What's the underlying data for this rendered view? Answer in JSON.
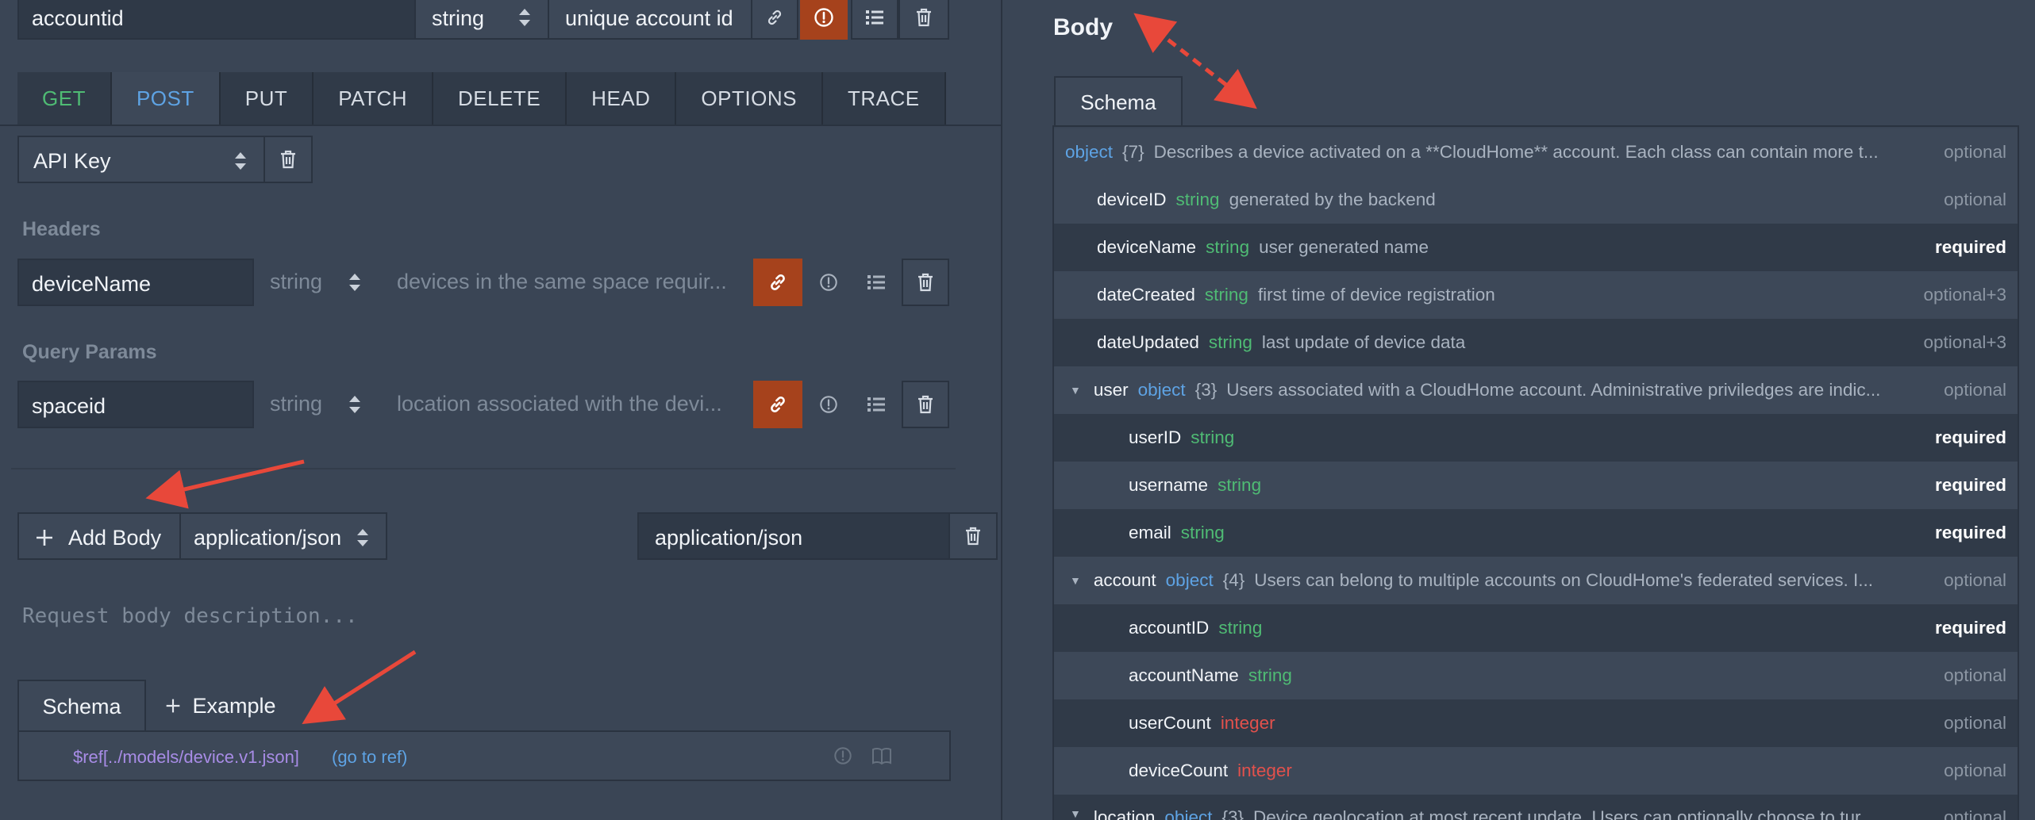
{
  "param_row": {
    "name": "accountid",
    "type": "string",
    "description": "unique account id"
  },
  "methods": [
    "GET",
    "POST",
    "PUT",
    "PATCH",
    "DELETE",
    "HEAD",
    "OPTIONS",
    "TRACE"
  ],
  "active_method": "POST",
  "auth": {
    "selected": "API Key"
  },
  "headers": {
    "label": "Headers",
    "name": "deviceName",
    "type": "string",
    "description": "devices in the same space requir..."
  },
  "query": {
    "label": "Query Params",
    "name": "spaceid",
    "type": "string",
    "description": "location associated with the devi..."
  },
  "body_editor": {
    "add_body_label": "Add Body",
    "content_type": "application/json",
    "content_type_field": "application/json",
    "description_placeholder": "Request body description...",
    "tabs": [
      "Schema",
      "Example"
    ],
    "ref_text": "$ref[../models/device.v1.json]",
    "go_to_ref": "(go to ref)"
  },
  "preview": {
    "title": "Body",
    "tab": "Schema",
    "rows": [
      {
        "name": "object",
        "type": "",
        "count": "{7}",
        "desc": "Describes a device activated on a **CloudHome** account. Each class can contain more t...",
        "flag": "optional"
      },
      {
        "name": "deviceID",
        "type": "string",
        "desc": "generated by the backend",
        "flag": "optional"
      },
      {
        "name": "deviceName",
        "type": "string",
        "desc": "user generated name",
        "flag": "required"
      },
      {
        "name": "dateCreated",
        "type": "string",
        "desc": "first time of device registration",
        "flag": "optional+3"
      },
      {
        "name": "dateUpdated",
        "type": "string",
        "desc": "last update of device data",
        "flag": "optional+3"
      },
      {
        "name": "user",
        "type": "object",
        "count": "{3}",
        "desc": "Users associated with a CloudHome account. Administrative priviledges are indic...",
        "flag": "optional"
      },
      {
        "name": "userID",
        "type": "string",
        "desc": "",
        "flag": "required"
      },
      {
        "name": "username",
        "type": "string",
        "desc": "",
        "flag": "required"
      },
      {
        "name": "email",
        "type": "string",
        "desc": "",
        "flag": "required"
      },
      {
        "name": "account",
        "type": "object",
        "count": "{4}",
        "desc": "Users can belong to multiple accounts on CloudHome's federated services. I...",
        "flag": "optional"
      },
      {
        "name": "accountID",
        "type": "string",
        "desc": "",
        "flag": "required"
      },
      {
        "name": "accountName",
        "type": "string",
        "desc": "",
        "flag": "optional"
      },
      {
        "name": "userCount",
        "type": "integer",
        "desc": "",
        "flag": "optional"
      },
      {
        "name": "deviceCount",
        "type": "integer",
        "desc": "",
        "flag": "optional"
      },
      {
        "name": "location",
        "type": "object",
        "count": "{3}",
        "desc": "Device geolocation at most recent update. Users can optionally choose to tur...",
        "flag": "optional"
      }
    ]
  },
  "colors": {
    "background": "#3a4555",
    "accent_orange": "#a6421c",
    "string_type": "#4fbb74",
    "object_type": "#5ea3e4",
    "integer_type": "#e2514c",
    "annotation_arrow": "#e8483a"
  }
}
